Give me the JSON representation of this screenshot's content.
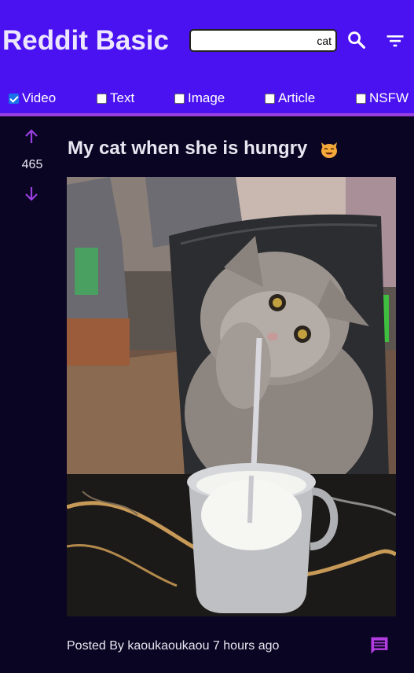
{
  "header": {
    "brand": "Reddit Basic",
    "search_value": "cat",
    "search_icon": "search-icon",
    "filter_icon": "filter-icon",
    "background": "#4a12f0"
  },
  "filters": [
    {
      "label": "Video",
      "checked": true
    },
    {
      "label": "Text",
      "checked": false
    },
    {
      "label": "Image",
      "checked": false
    },
    {
      "label": "Article",
      "checked": false
    },
    {
      "label": "NSFW",
      "checked": false
    }
  ],
  "post": {
    "score": "465",
    "title": "My cat when she is hungry",
    "title_emoji": "cat-emoji",
    "image_description": "cat-drinking-milk-photo",
    "posted_by_prefix": "Posted By",
    "author": "kaoukaoukaou",
    "time_ago": "7 hours ago",
    "comment_icon": "comment-icon"
  },
  "colors": {
    "accent": "#9a3fe0",
    "page_background": "#0b0524",
    "text": "#e8e6f0"
  }
}
